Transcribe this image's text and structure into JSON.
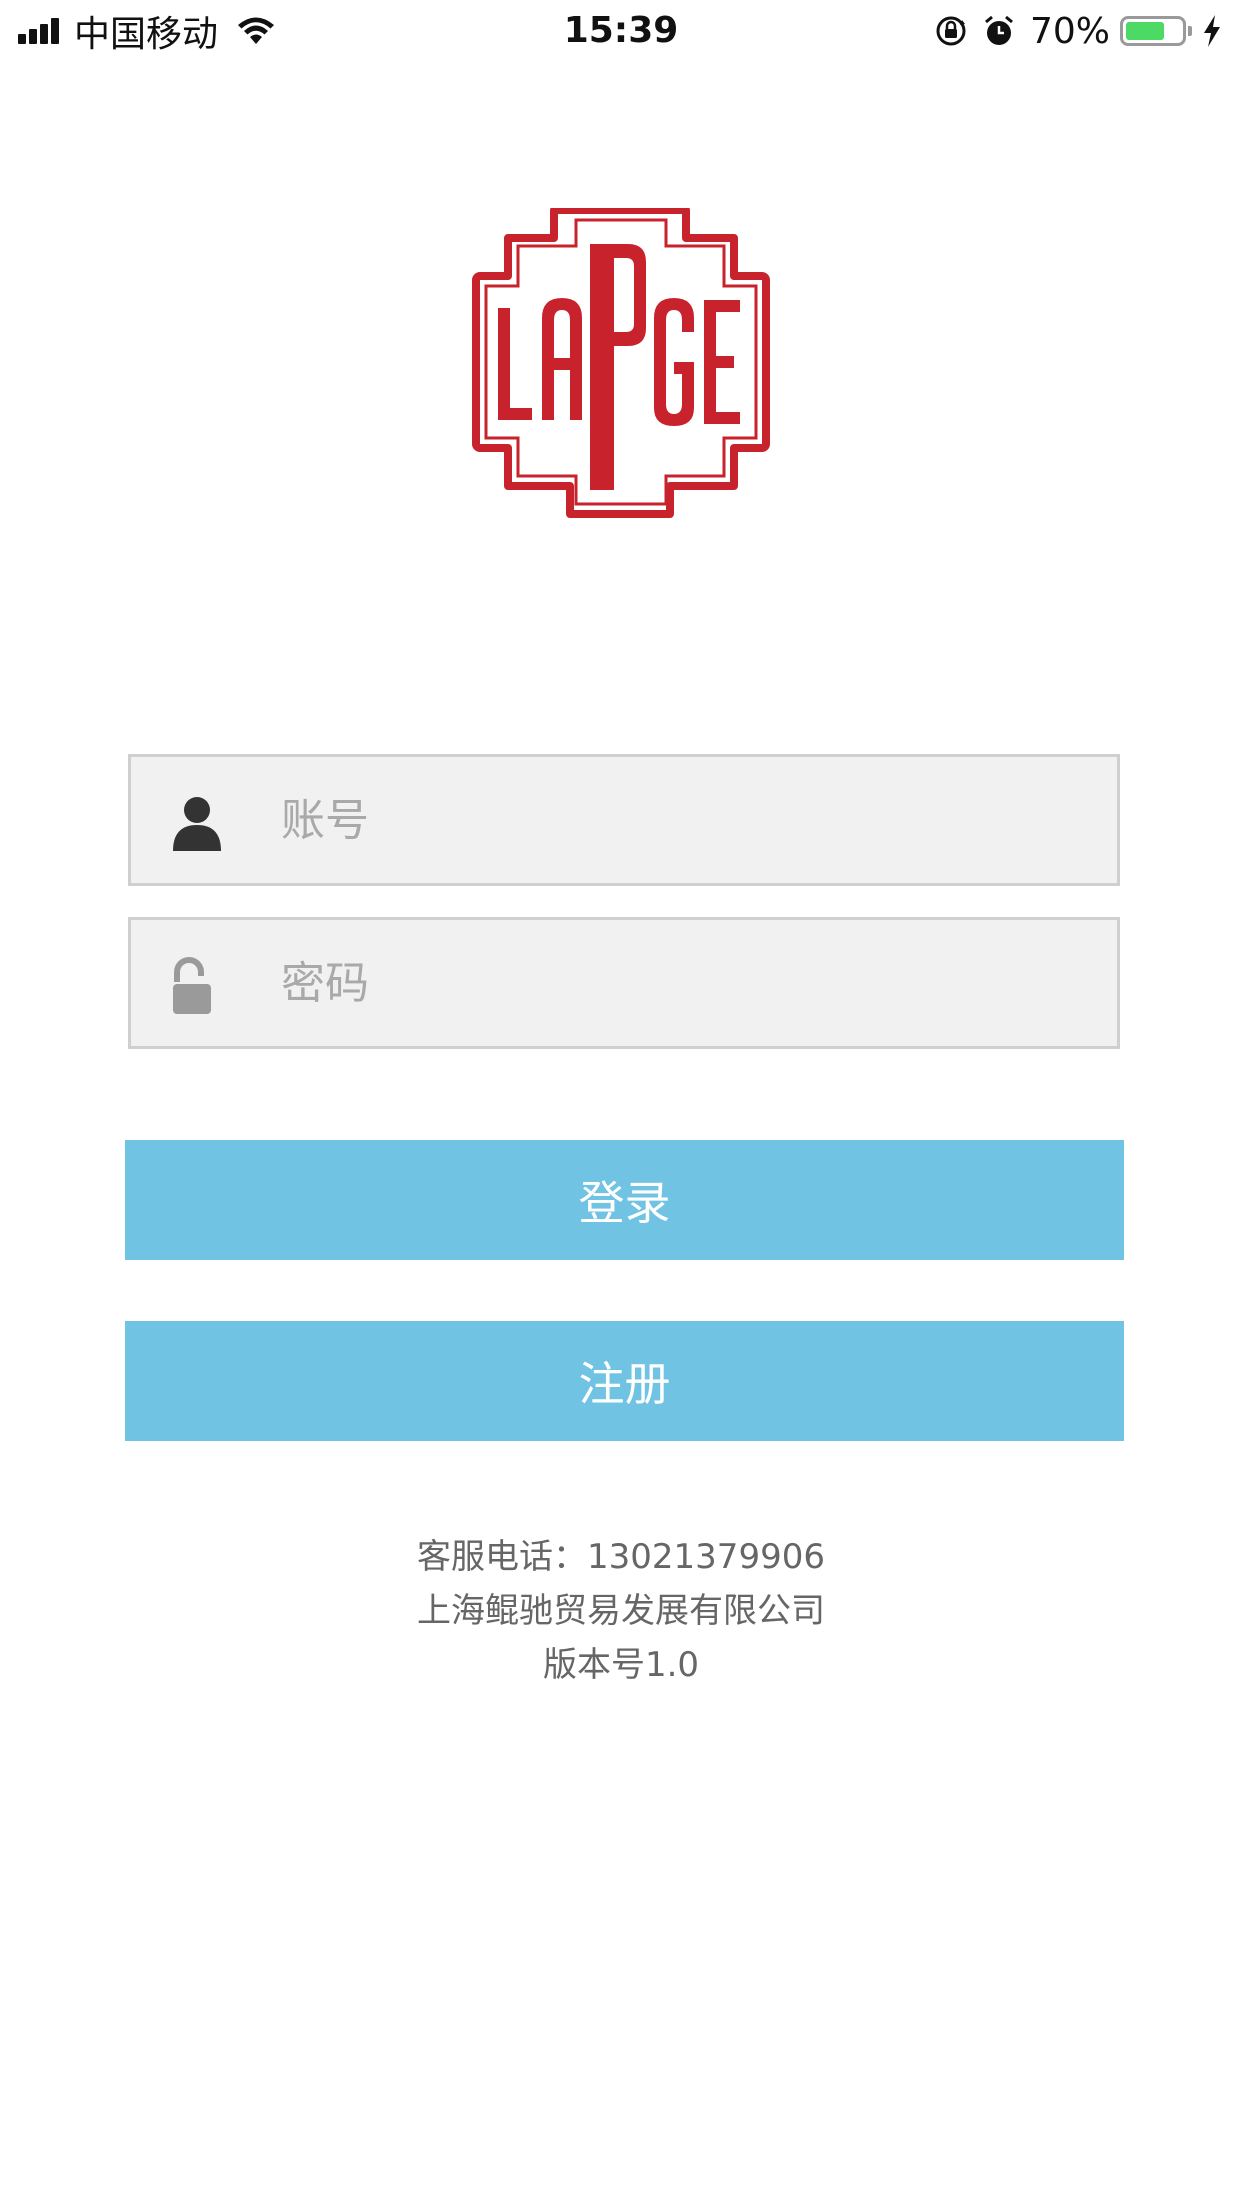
{
  "status_bar": {
    "carrier": "中国移动",
    "time": "15:39",
    "battery_percent": "70%",
    "battery_level": 0.7,
    "battery_color": "#4cd964",
    "icons": [
      "signal-bars-icon",
      "wifi-icon",
      "orientation-lock-icon",
      "alarm-icon",
      "battery-icon",
      "charging-bolt-icon"
    ]
  },
  "logo": {
    "icon": "lapge-logo",
    "color": "#c8232c"
  },
  "form": {
    "account": {
      "placeholder": "账号",
      "value": "",
      "icon": "user-icon"
    },
    "password": {
      "placeholder": "密码",
      "value": "",
      "icon": "unlock-icon"
    }
  },
  "buttons": {
    "login_label": "登录",
    "register_label": "注册",
    "color": "#71c3e3"
  },
  "footer": {
    "service_phone": "客服电话：13021379906",
    "company": "上海鲲驰贸易发展有限公司",
    "version": "版本号1.0"
  }
}
